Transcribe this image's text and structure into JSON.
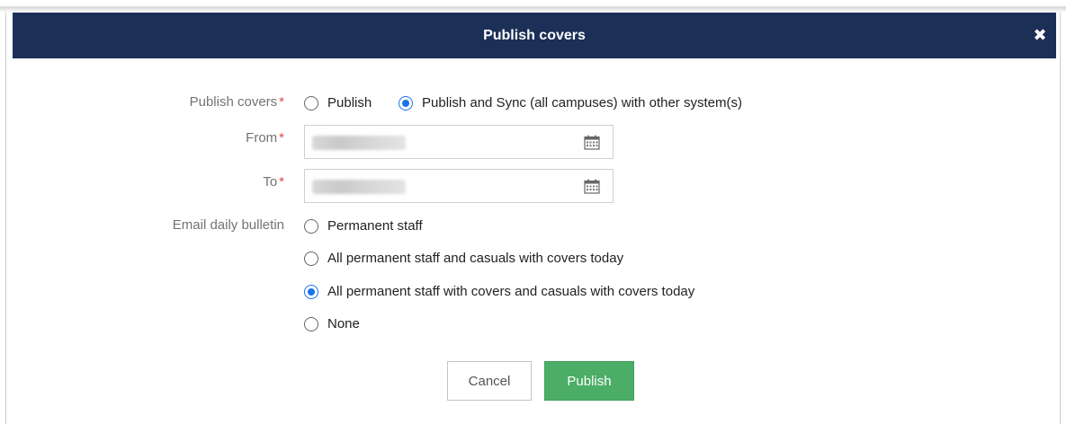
{
  "modal": {
    "title": "Publish covers",
    "close_icon": "close-icon"
  },
  "form": {
    "publish_covers": {
      "label": "Publish covers",
      "required_marker": "*",
      "options": [
        {
          "label": "Publish",
          "checked": false
        },
        {
          "label": "Publish and Sync (all campuses) with other system(s)",
          "checked": true
        }
      ]
    },
    "from": {
      "label": "From",
      "required_marker": "*",
      "value_obscured": true,
      "icon": "calendar-icon"
    },
    "to": {
      "label": "To",
      "required_marker": "*",
      "value_obscured": true,
      "icon": "calendar-icon"
    },
    "email_daily_bulletin": {
      "label": "Email daily bulletin",
      "options": [
        {
          "label": "Permanent staff",
          "checked": false
        },
        {
          "label": "All permanent staff and casuals with covers today",
          "checked": false
        },
        {
          "label": "All permanent staff with covers and casuals with covers today",
          "checked": true
        },
        {
          "label": "None",
          "checked": false
        }
      ]
    }
  },
  "buttons": {
    "cancel_label": "Cancel",
    "publish_label": "Publish"
  },
  "colors": {
    "header_bg": "#1b2f57",
    "accent_blue": "#1a73e8",
    "publish_green": "#4cad66",
    "required_red": "#d94a4a"
  }
}
